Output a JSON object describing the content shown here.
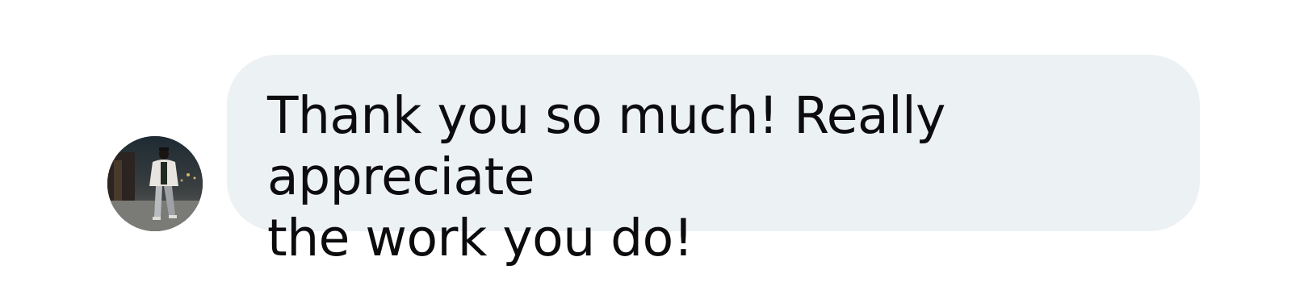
{
  "message": {
    "text": "Thank you so much! Really appreciate\nthe work you do!",
    "bubble_color": "#ecf1f4",
    "text_color": "#0c0c0e"
  },
  "sender": {
    "avatar_icon": "user-avatar-photo"
  }
}
